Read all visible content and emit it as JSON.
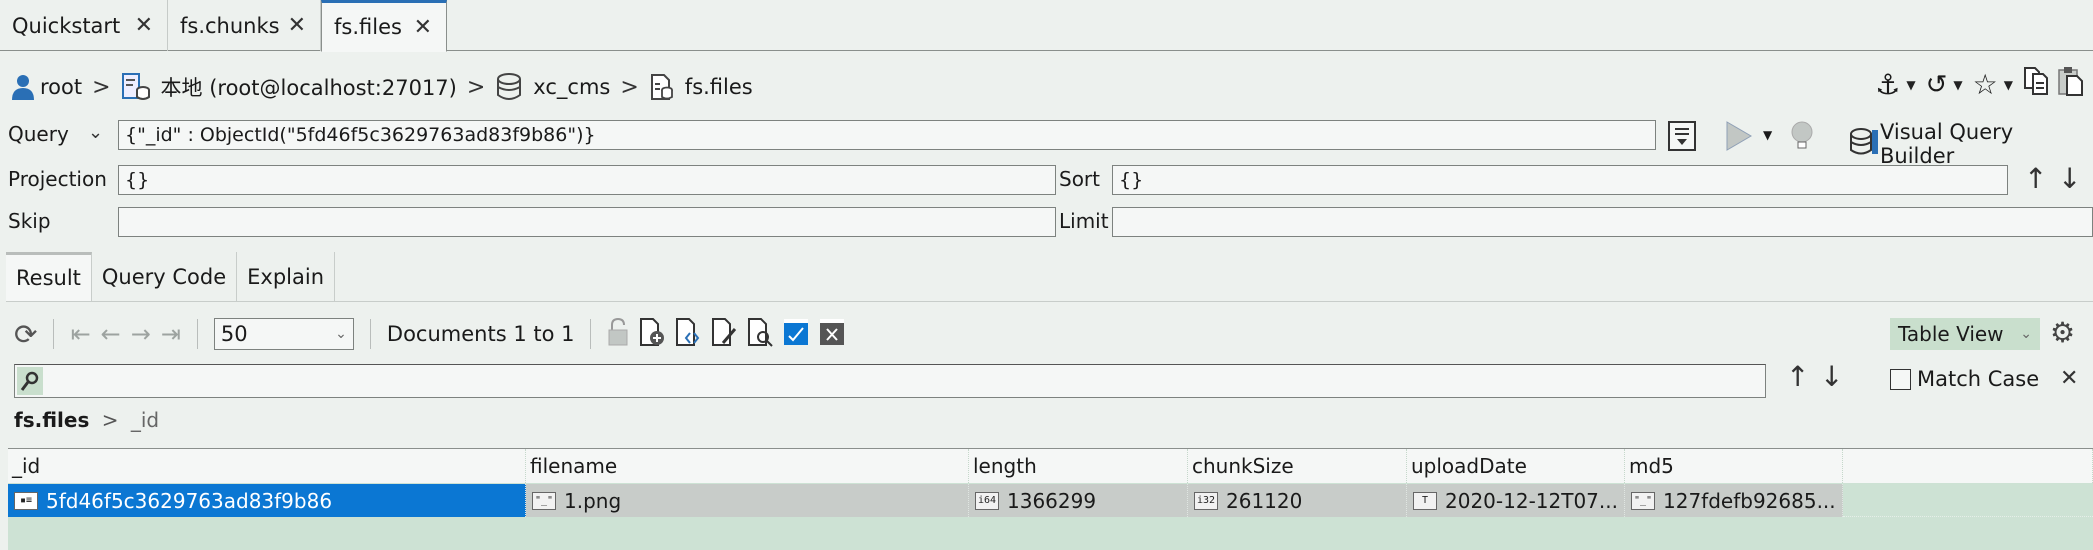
{
  "tabs": [
    {
      "label": "Quickstart",
      "active": false
    },
    {
      "label": "fs.chunks",
      "active": false
    },
    {
      "label": "fs.files",
      "active": true
    }
  ],
  "close_glyph": "✕",
  "breadcrumb": {
    "user": "root",
    "connection": "本地 (root@localhost:27017)",
    "database": "xc_cms",
    "collection": "fs.files",
    "separator": ">"
  },
  "top_icons": [
    "anchor-icon",
    "history-icon",
    "star-icon",
    "copy-icon",
    "paste-icon"
  ],
  "query": {
    "mode_label": "Query",
    "value": "{\"_id\" : ObjectId(\"5fd46f5c3629763ad83f9b86\")}",
    "projection_label": "Projection",
    "projection_value": "{}",
    "sort_label": "Sort",
    "sort_value": "{}",
    "skip_label": "Skip",
    "skip_value": "",
    "limit_label": "Limit",
    "limit_value": "",
    "visual_query_builder_label": "Visual Query Builder"
  },
  "result_tabs": [
    {
      "label": "Result",
      "active": true
    },
    {
      "label": "Query Code",
      "active": false
    },
    {
      "label": "Explain",
      "active": false
    }
  ],
  "toolbar": {
    "page_size": "50",
    "documents_label": "Documents 1 to 1",
    "view_mode": "Table View"
  },
  "search": {
    "value": "",
    "match_case_label": "Match Case",
    "match_case_checked": false
  },
  "grid": {
    "path_root": "fs.files",
    "path_field": "_id",
    "columns": [
      "_id",
      "filename",
      "length",
      "chunkSize",
      "uploadDate",
      "md5"
    ],
    "rows": [
      {
        "cells": [
          {
            "type_badge": "▪≡",
            "value": "5fd46f5c3629763ad83f9b86",
            "selected": true
          },
          {
            "type_badge": "\"_\"",
            "value": "1.png"
          },
          {
            "type_badge": "i64",
            "value": "1366299"
          },
          {
            "type_badge": "i32",
            "value": "261120"
          },
          {
            "type_badge": "T",
            "value": "2020-12-12T07..."
          },
          {
            "type_badge": "\"_\"",
            "value": "127fdefb92685..."
          }
        ]
      }
    ]
  },
  "colors": {
    "selection": "#0b77d3",
    "grid_bg": "#cde2d4",
    "accent_tab": "#2a6fb5"
  }
}
